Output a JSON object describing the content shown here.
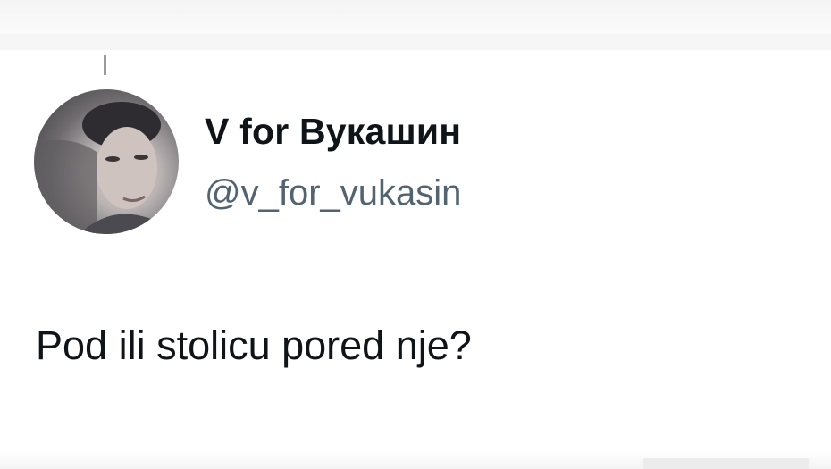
{
  "tweet": {
    "display_name": "V for Вукашин",
    "handle": "@v_for_vukasin",
    "text": "Pod ili stolicu pored nje?",
    "avatar_icon": "profile-photo"
  },
  "colors": {
    "text_primary": "#0f1419",
    "text_secondary": "#536471",
    "background": "#ffffff"
  }
}
